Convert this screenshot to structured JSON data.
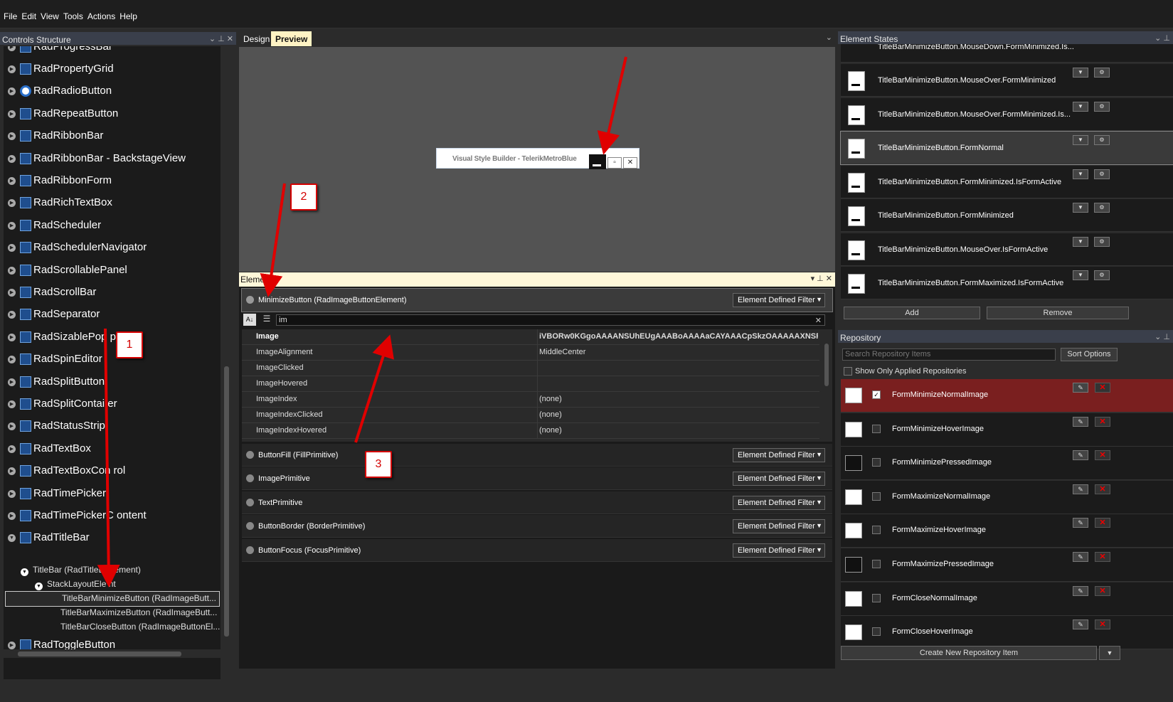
{
  "menu": [
    "File",
    "Edit",
    "View",
    "Tools",
    "Actions",
    "Help"
  ],
  "left_panel": {
    "title": "Controls Structure",
    "items": [
      "RadPropertyGrid",
      "RadRadioButton",
      "RadRepeatButton",
      "RadRibbonBar",
      "RadRibbonBar - BackstageView",
      "RadRibbonForm",
      "RadRichTextBox",
      "RadScheduler",
      "RadSchedulerNavigator",
      "RadScrollablePanel",
      "RadScrollBar",
      "RadSeparator",
      "RadSizablePop",
      "RadSpinEditor",
      "RadSplitButton",
      "RadSplitContai",
      "RadStatusStrip",
      "RadTextBox",
      "RadTextBoxCon",
      "RadTimePicker",
      "RadTimePickerC",
      "RadTitleBar"
    ],
    "partial_top": "RadProgressBar",
    "sub_items": [
      "TitleBar (RadTitleBar",
      "StackLayoutEle",
      "TitleBarMinimizeButton  (RadImageButt...",
      "TitleBarMaximizeButton  (RadImageButt...",
      "TitleBarCloseButton  (RadImageButtonEl..."
    ],
    "sub_suffixes": [
      "ement)",
      "nt"
    ],
    "last_item": "RadToggleButton",
    "label_suffixes": {
      "RadSizablePop": "p",
      "RadSplitContai": "er",
      "RadTextBoxCon": "rol",
      "RadTimePickerC": "ontent"
    }
  },
  "center": {
    "tabs": [
      "Design",
      "Preview"
    ],
    "preview_title": "Visual Style Builder - TelerikMetroBlue",
    "element_panel_title": "Element",
    "main_group": "MinimizeButton (RadImageButtonElement)",
    "filter_label": "Element Defined Filter",
    "search_text": "im",
    "properties": [
      {
        "name": "Image",
        "value": "iVBORw0KGgoAAAANSUhEUgAAABoAAAAaCAYAAACpSkzOAAAAAXNSR0I"
      },
      {
        "name": "ImageAlignment",
        "value": "MiddleCenter"
      },
      {
        "name": "ImageClicked",
        "value": ""
      },
      {
        "name": "ImageHovered",
        "value": ""
      },
      {
        "name": "ImageIndex",
        "value": "(none)"
      },
      {
        "name": "ImageIndexClicked",
        "value": "(none)"
      },
      {
        "name": "ImageIndexHovered",
        "value": "(none)"
      }
    ],
    "groups": [
      "ButtonFill (FillPrimitive)",
      "ImagePrimitive",
      "TextPrimitive",
      "ButtonBorder (BorderPrimitive)",
      "ButtonFocus (FocusPrimitive)"
    ]
  },
  "right": {
    "states_title": "Element States",
    "states_partial": "TitleBarMinimizeButton.MouseDown.FormMinimized.Is...",
    "states": [
      "TitleBarMinimizeButton.MouseOver.FormMinimized",
      "TitleBarMinimizeButton.MouseOver.FormMinimized.Is...",
      "TitleBarMinimizeButton.FormNormal",
      "TitleBarMinimizeButton.FormMinimized.IsFormActive",
      "TitleBarMinimizeButton.FormMinimized",
      "TitleBarMinimizeButton.MouseOver.IsFormActive",
      "TitleBarMinimizeButton.FormMaximized.IsFormActive"
    ],
    "add_label": "Add",
    "remove_label": "Remove",
    "repo_title": "Repository",
    "repo_search_placeholder": "Search Repository Items",
    "sort_label": "Sort Options",
    "show_applied": "Show Only Applied Repositories",
    "repo_items": [
      "FormMinimizeNormalImage",
      "FormMinimizeHoverImage",
      "FormMinimizePressedImage",
      "FormMaximizeNormalImage",
      "FormMaximizeHoverImage",
      "FormMaximizePressedImage",
      "FormCloseNormalImage",
      "FormCloseHoverImage"
    ],
    "create_label": "Create New Repository Item"
  },
  "callouts": [
    "1",
    "2",
    "3"
  ],
  "colors": {
    "accent": "#d40000",
    "selected_repo": "#7a1f1f",
    "element_header": "#fff8d9"
  }
}
